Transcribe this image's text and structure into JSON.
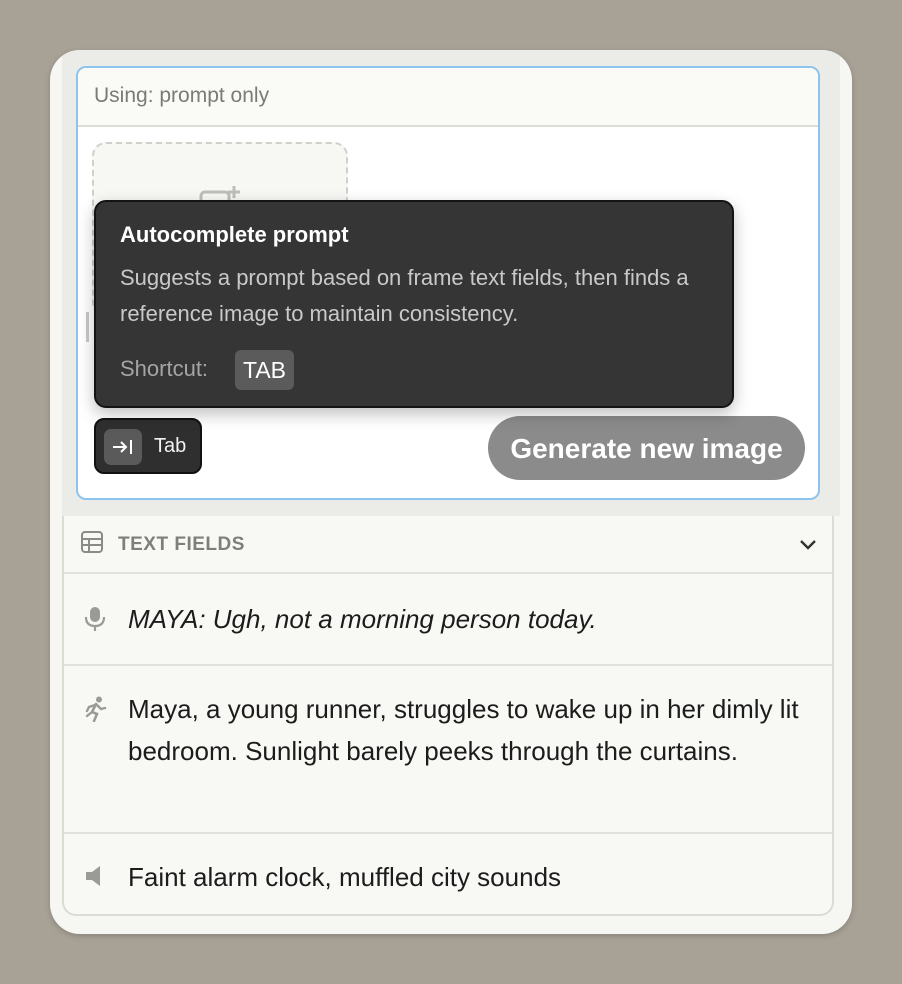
{
  "prompt_panel": {
    "using_label": "Using: prompt only",
    "tab_button_label": "Tab",
    "generate_button_label": "Generate new image"
  },
  "tooltip": {
    "title": "Autocomplete prompt",
    "description": "Suggests a prompt based on frame text fields, then finds a reference image to maintain consistency.",
    "shortcut_label": "Shortcut:",
    "shortcut_key": "TAB"
  },
  "text_fields": {
    "header": "TEXT FIELDS",
    "items": [
      {
        "icon": "microphone-icon",
        "text": "MAYA: Ugh, not a morning person today.",
        "italic": true
      },
      {
        "icon": "running-person-icon",
        "text": "Maya, a young runner, struggles to wake up in her dimly lit bedroom. Sunlight barely peeks through the curtains.",
        "italic": false
      },
      {
        "icon": "speaker-icon",
        "text": "Faint alarm clock, muffled city sounds",
        "italic": false
      }
    ]
  },
  "colors": {
    "background": "#a8a196",
    "prompt_border": "#8ec3ee",
    "tooltip_bg": "#353535",
    "generate_button_bg": "#8b8b8b"
  }
}
